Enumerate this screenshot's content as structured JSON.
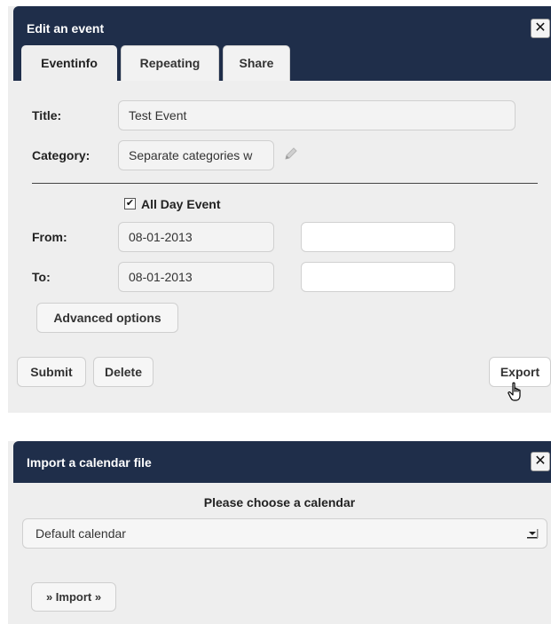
{
  "edit_dialog": {
    "title": "Edit an event",
    "close_glyph": "✕",
    "tabs": [
      {
        "label": "Eventinfo",
        "active": true
      },
      {
        "label": "Repeating",
        "active": false
      },
      {
        "label": "Share",
        "active": false
      }
    ],
    "title_label": "Title:",
    "title_value": "Test Event",
    "category_label": "Category:",
    "category_value": "Separate categories w",
    "all_day_label": "All Day Event",
    "all_day_checked": true,
    "all_day_glyph": "✔",
    "from_label": "From:",
    "from_date": "08-01-2013",
    "from_time": "",
    "to_label": "To:",
    "to_date": "08-01-2013",
    "to_time": "",
    "advanced_button": "Advanced options",
    "submit_button": "Submit",
    "delete_button": "Delete",
    "export_button": "Export"
  },
  "import_dialog": {
    "title": "Import a calendar file",
    "close_glyph": "✕",
    "choose_label": "Please choose a calendar",
    "calendar_selected": "Default calendar",
    "import_button": "» Import »"
  },
  "icons": {
    "close": "close-icon",
    "pencil": "pencil-icon",
    "cursor": "hand-cursor-icon",
    "dropdown": "dropdown-arrow-icon"
  },
  "colors": {
    "titlebar": "#1f2e4a",
    "dialog_bg": "#eeeeee",
    "field_bg": "#f3f3f3"
  }
}
